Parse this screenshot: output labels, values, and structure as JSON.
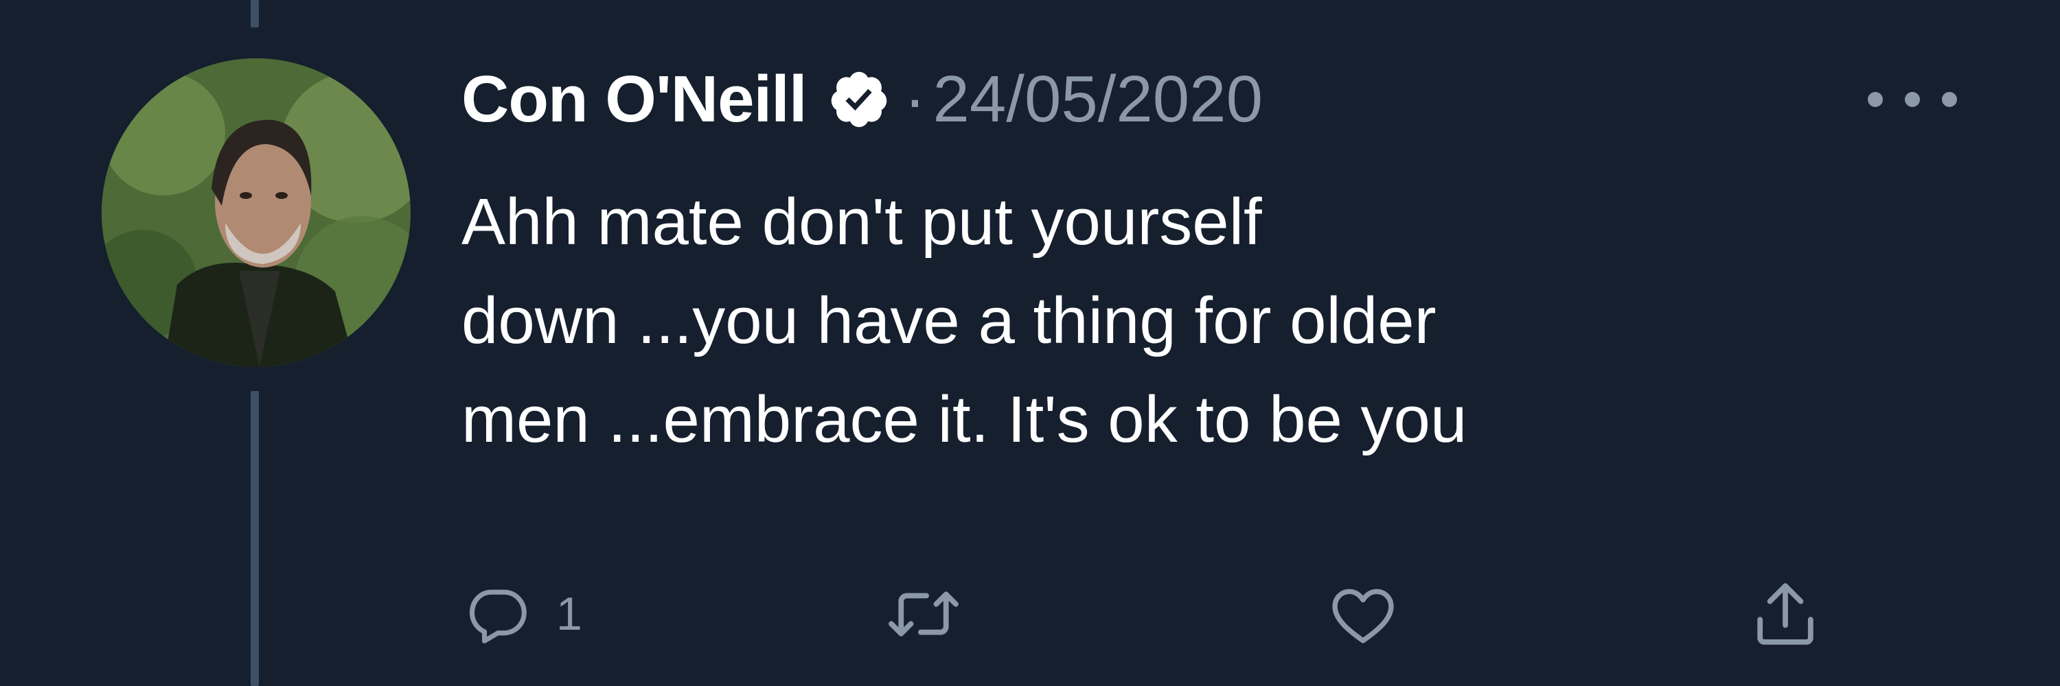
{
  "tweet": {
    "author": {
      "display_name": "Con O'Neill",
      "verified": true
    },
    "separator": "·",
    "date": "24/05/2020",
    "text_lines": [
      "Ahh mate don't put yourself",
      "down ...you have a thing for older",
      "men ...embrace it. It's ok to be you"
    ],
    "actions": {
      "reply_count": "1",
      "retweet_count": "",
      "like_count": ""
    }
  },
  "icons": {
    "verified": "verified-badge-icon",
    "more": "more-options-icon",
    "reply": "reply-icon",
    "retweet": "retweet-icon",
    "like": "heart-icon",
    "share": "share-icon"
  },
  "colors": {
    "background": "#151f2e",
    "primary_text": "#ffffff",
    "secondary_text": "#8b98a5",
    "thread_line": "#3d5166"
  }
}
